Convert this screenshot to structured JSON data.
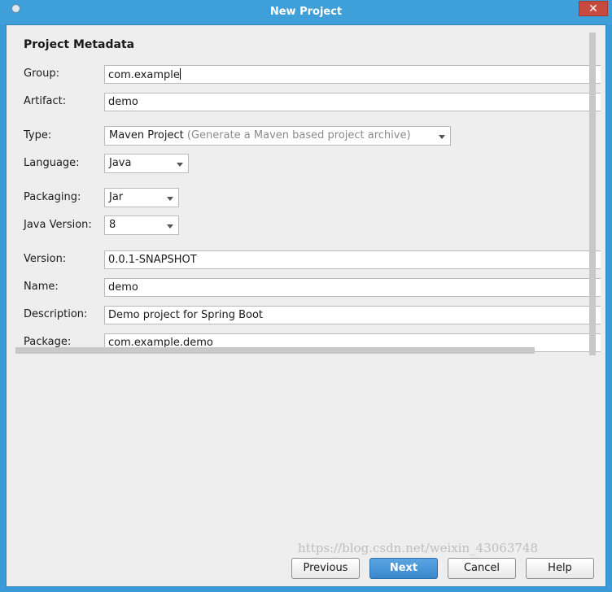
{
  "window": {
    "title": "New Project",
    "close_glyph": "✕"
  },
  "form": {
    "section_title": "Project Metadata",
    "group": {
      "label": "Group:",
      "value": "com.example"
    },
    "artifact": {
      "label": "Artifact:",
      "value": "demo"
    },
    "type": {
      "label": "Type:",
      "value": "Maven Project",
      "hint": "(Generate a Maven based project archive)"
    },
    "language": {
      "label": "Language:",
      "value": "Java"
    },
    "packaging": {
      "label": "Packaging:",
      "value": "Jar"
    },
    "java_version": {
      "label": "Java Version:",
      "value": "8"
    },
    "version": {
      "label": "Version:",
      "value": "0.0.1-SNAPSHOT"
    },
    "name": {
      "label": "Name:",
      "value": "demo"
    },
    "description": {
      "label": "Description:",
      "value": "Demo project for Spring Boot"
    },
    "package": {
      "label": "Package:",
      "value": "com.example.demo"
    }
  },
  "buttons": {
    "previous": "Previous",
    "next": "Next",
    "cancel": "Cancel",
    "help": "Help"
  },
  "watermark": "https://blog.csdn.net/weixin_43063748",
  "colors": {
    "titlebar": "#3f9fd8",
    "close_button": "#c74a3f",
    "primary_button": "#3a87cc"
  }
}
